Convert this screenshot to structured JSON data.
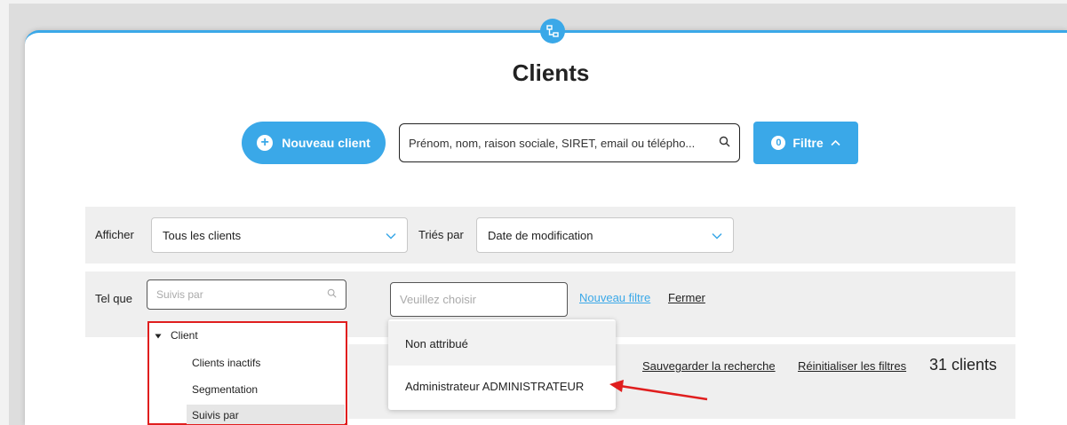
{
  "header": {
    "title": "Clients",
    "module_icon": "org-chart-icon",
    "accent_color": "#3aa8e8"
  },
  "toolbar": {
    "new_client_label": "Nouveau client",
    "search_placeholder": "Prénom, nom, raison sociale, SIRET, email ou télépho...",
    "filter_count": "0",
    "filter_label": "Filtre"
  },
  "filters": {
    "show_label": "Afficher",
    "show_value": "Tous les clients",
    "sort_label": "Triés par",
    "sort_value": "Date de modification",
    "such_as_label": "Tel que",
    "criteria_placeholder": "Suivis par",
    "value_placeholder": "Veuillez choisir",
    "new_filter_link": "Nouveau filtre",
    "close_link": "Fermer"
  },
  "criteria_tree": {
    "group_label": "Client",
    "items": [
      "Clients inactifs",
      "Segmentation",
      "Suivis par"
    ],
    "selected_index": 2
  },
  "value_dropdown": {
    "options": [
      "Non attribué",
      "Administrateur ADMINISTRATEUR"
    ],
    "highlighted_index": 0
  },
  "results": {
    "save_search_link": "Sauvegarder la recherche",
    "reset_filters_link": "Réinitialiser les filtres",
    "count_label": "31 clients"
  },
  "annotation": {
    "highlight_color": "#e01e1e"
  }
}
